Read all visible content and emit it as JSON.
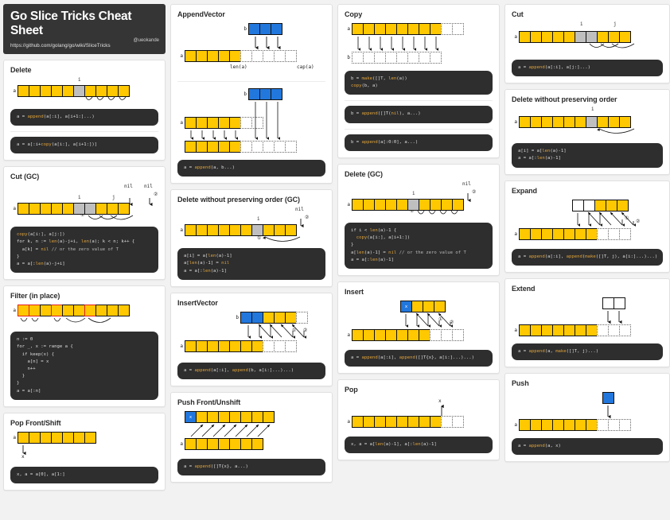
{
  "header": {
    "title": "Go Slice Tricks Cheat Sheet",
    "url": "https://github.com/golang/go/wiki/SliceTricks",
    "handle": "@ueokande"
  },
  "labels": {
    "a": "a",
    "b": "b",
    "x": "x",
    "i": "i",
    "j": "j",
    "nil": "nil",
    "one": "①",
    "two": "②",
    "len_a": "len(a)",
    "cap_a": "cap(a)"
  },
  "cards": [
    {
      "id": "delete",
      "title": "Delete",
      "codes": [
        "a = append(a[:i], a[i+1:]...)",
        "a = a[:i+copy(a[i:], a[i+1:])]"
      ]
    },
    {
      "id": "cut-gc",
      "title": "Cut (GC)",
      "codes": [
        "copy(a[i:], a[j:])\nfor k, n := len(a)-j+i, len(a); k < n; k++ {\n  a[k] = nil // or the zero value of T\n}\na = a[:len(a)-j+i]"
      ]
    },
    {
      "id": "filter-in-place",
      "title": "Filter (in place)",
      "codes": [
        "n := 0\nfor _, x := range a {\n  if keep(x) {\n    a[n] = x\n    n++\n  }\n}\na = a[:n]"
      ]
    },
    {
      "id": "pop-front-shift",
      "title": "Pop Front/Shift",
      "codes": [
        "x, a = a[0], a[1:]"
      ]
    },
    {
      "id": "append-vector",
      "title": "AppendVector",
      "codes": [
        "a = append(a, b...)"
      ]
    },
    {
      "id": "delete-without-preserving-order-gc",
      "title": "Delete without preserving order (GC)",
      "codes": [
        "a[i] = a[len(a)-1]\na[len(a)-1] = nil\na = a[:len(a)-1]"
      ]
    },
    {
      "id": "insert-vector",
      "title": "InsertVector",
      "codes": [
        "a = append(a[:i], append(b, a[i:]...)...)"
      ]
    },
    {
      "id": "push-front-unshift",
      "title": "Push Front/Unshift",
      "codes": [
        "a = append([]T{x}, a...)"
      ]
    },
    {
      "id": "copy",
      "title": "Copy",
      "codes": [
        "b = make([]T, len(a))\ncopy(b, a)",
        "b = append([]T(nil), a...)",
        "b = append(a[:0:0], a...)"
      ]
    },
    {
      "id": "delete-gc",
      "title": "Delete (GC)",
      "codes": [
        "if i < len(a)-1 {\n  copy(a[i:], a[i+1:])\n}\na[len(a)-1] = nil // or the zero value of T\na = a[:len(a)-1]"
      ]
    },
    {
      "id": "insert",
      "title": "Insert",
      "codes": [
        "a = append(a[:i], append([]T{x}, a[i:]...)...)"
      ]
    },
    {
      "id": "pop",
      "title": "Pop",
      "codes": [
        "x, a = a[len(a)-1], a[:len(a)-1]"
      ]
    },
    {
      "id": "cut",
      "title": "Cut",
      "codes": [
        "a = append(a[:i], a[j:]...)"
      ]
    },
    {
      "id": "delete-without-preserving-order",
      "title": "Delete without preserving order",
      "codes": [
        "a[i] = a[len(a)-1]\na = a[:len(a)-1]"
      ]
    },
    {
      "id": "expand",
      "title": "Expand",
      "codes": [
        "a = append(a[:i], append(make([]T, j), a[i:]...)...)"
      ]
    },
    {
      "id": "extend",
      "title": "Extend",
      "codes": [
        "a = append(a, make([]T, j)...)"
      ]
    },
    {
      "id": "push",
      "title": "Push",
      "codes": [
        "a = append(a, x)"
      ]
    }
  ],
  "colors": {
    "slice_cell": "#ffc800",
    "removed_cell": "#bfbfbf",
    "inserted_cell": "#2277dd",
    "highlight_border": "#e02020",
    "code_bg": "#2e2e2e",
    "banner_bg": "#353535",
    "page_bg": "#f2f2f2"
  }
}
